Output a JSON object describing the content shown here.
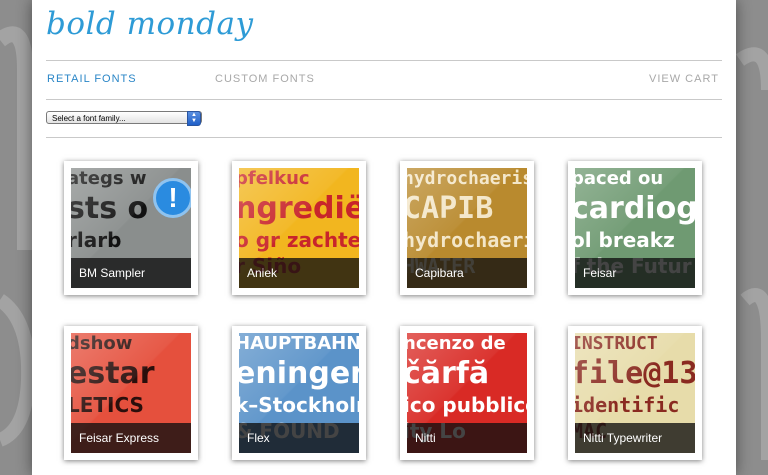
{
  "site": {
    "logo": "bold monday"
  },
  "nav": {
    "retail": "RETAIL FONTS",
    "custom": "CUSTOM FONTS",
    "cart": "VIEW CART"
  },
  "font_select": {
    "selected": "Select a font family..."
  },
  "fonts": [
    {
      "name": "BM Sampler",
      "bg": "#8a8e8d",
      "fg": "#111111",
      "sample_lines": [
        "ategs w",
        "sts o",
        "rlarb"
      ]
    },
    {
      "name": "Aniek",
      "bg": "#f2b61f",
      "fg": "#c8252b",
      "sample_lines": [
        "pfelkuc",
        "ngrediën",
        "o gr zachte",
        "r Siño"
      ]
    },
    {
      "name": "Capibara",
      "bg": "#b98a2e",
      "fg": "#f3e6c8",
      "sample_lines": [
        "hydrochaeris h",
        "CAPIB",
        "hydrochaeris i",
        "HWATER"
      ]
    },
    {
      "name": "Feisar",
      "bg": "#6f9a72",
      "fg": "#ffffff",
      "sample_lines": [
        "paced ou",
        "cardiogramm",
        "ol breakz",
        "f the Futur"
      ]
    },
    {
      "name": "Feisar Express",
      "bg": "#e5503d",
      "fg": "#2a0f0c",
      "sample_lines": [
        "dshow",
        "estar",
        "LETICS"
      ]
    },
    {
      "name": "Flex",
      "bg": "#5b93c9",
      "fg": "#ffffff",
      "sample_lines": [
        "HAUPTBAHNHO",
        "eningen",
        "k–Stockholm Arland",
        "& FOUND"
      ]
    },
    {
      "name": "Nitti",
      "bg": "#d92a25",
      "fg": "#ffffff",
      "sample_lines": [
        "ncenzo de",
        "čărfă",
        "ico pubblico n",
        "ity Lo"
      ]
    },
    {
      "name": "Nitti Typewriter",
      "bg": "#e7dcaa",
      "fg": "#8a2a20",
      "sample_lines": [
        "INSTRUCT",
        "file@13",
        "identific",
        "MAC"
      ]
    }
  ],
  "colors": {
    "accent": "#2e9bd6",
    "nav_active": "#2a86c7",
    "nav_inactive": "#a8a8a8"
  },
  "icons": {
    "badge": "exclamation-icon"
  }
}
